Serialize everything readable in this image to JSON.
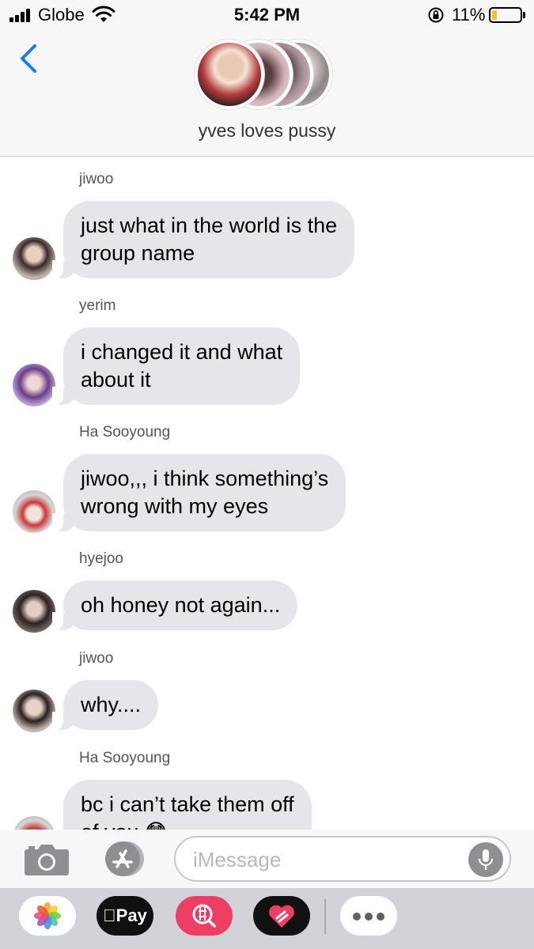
{
  "status_bar": {
    "carrier": "Globe",
    "time": "5:42 PM",
    "battery_percent": "11%",
    "battery_level": 0.11,
    "icons": [
      "signal-icon",
      "wifi-icon",
      "orientation-lock-icon",
      "battery-icon"
    ]
  },
  "header": {
    "group_title": "yves loves pussy",
    "back_icon": "chevron-left-icon"
  },
  "messages": [
    {
      "sender": "jiwoo",
      "text": "just what in the world is the\ngroup name"
    },
    {
      "sender": "yerim",
      "text": "i changed it and what\nabout it"
    },
    {
      "sender": "Ha Sooyoung",
      "text": "jiwoo,,,  i think something’s\nwrong with my eyes"
    },
    {
      "sender": "hyejoo",
      "text": "oh honey not again..."
    },
    {
      "sender": "jiwoo",
      "text": "why...."
    },
    {
      "sender": "Ha Sooyoung",
      "text": "bc i can’t take them off\nof you 😳"
    }
  ],
  "composer": {
    "placeholder": "iMessage",
    "icons": [
      "camera-icon",
      "app-store-icon",
      "microphone-icon"
    ]
  },
  "app_drawer": {
    "apple_pay_label": "Pay",
    "icons": [
      "photos-icon",
      "apple-pay-icon",
      "search-images-icon",
      "digital-touch-icon",
      "more-icon"
    ]
  },
  "colors": {
    "accent": "#1a7cf5",
    "bubble_gray": "#e5e5ea",
    "bar_background": "#f7f7f7",
    "drawer_background": "#d1d3d9",
    "battery_low": "#f5c02b"
  }
}
